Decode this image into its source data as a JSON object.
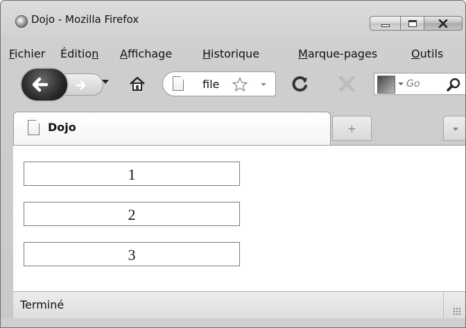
{
  "window": {
    "title": "Dojo - Mozilla Firefox"
  },
  "menubar": {
    "items": [
      {
        "label": "Fichier",
        "accesskey": "F"
      },
      {
        "label": "Édition",
        "accesskey": "n"
      },
      {
        "label": "Affichage",
        "accesskey": "A"
      },
      {
        "label": "Historique",
        "accesskey": "H"
      },
      {
        "label": "Marque-pages",
        "accesskey": "M"
      },
      {
        "label": "Outils",
        "accesskey": "O"
      }
    ]
  },
  "navbar": {
    "url": "file",
    "search_placeholder": "Go"
  },
  "tabs": {
    "active_label": "Dojo",
    "new_tab_glyph": "+"
  },
  "content": {
    "boxes": [
      {
        "label": "1"
      },
      {
        "label": "2"
      },
      {
        "label": "3"
      }
    ]
  },
  "statusbar": {
    "text": "Terminé"
  },
  "icons": {
    "app": "firefox-icon",
    "back": "back-arrow-icon",
    "forward": "forward-arrow-icon",
    "home": "home-icon",
    "page": "page-icon",
    "bookmark": "star-icon",
    "reload": "reload-icon",
    "stop": "stop-icon",
    "search_engine": "search-engine-icon",
    "search": "magnifier-icon"
  }
}
